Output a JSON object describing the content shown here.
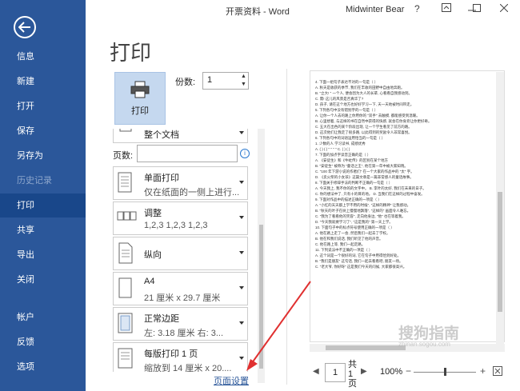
{
  "titlebar": {
    "title": "开票资料 - Word",
    "user": "Midwinter Bear",
    "help": "?"
  },
  "nav": {
    "items": [
      {
        "label": "信息"
      },
      {
        "label": "新建"
      },
      {
        "label": "打开"
      },
      {
        "label": "保存"
      },
      {
        "label": "另存为"
      },
      {
        "label": "历史记录"
      },
      {
        "label": "打印"
      },
      {
        "label": "共享"
      },
      {
        "label": "导出"
      },
      {
        "label": "关闭"
      },
      {
        "label": "帐户"
      },
      {
        "label": "反馈"
      },
      {
        "label": "选项"
      }
    ]
  },
  "page_title": "打印",
  "print_button": {
    "label": "打印"
  },
  "copies": {
    "label": "份数:",
    "value": "1"
  },
  "settings": {
    "print_all": "整个文档",
    "pages_label": "页数:",
    "sides": {
      "title": "单面打印",
      "subtitle": "仅在纸面的一侧上进行..."
    },
    "collate": {
      "title": "调整",
      "subtitle": "1,2,3    1,2,3    1,2,3"
    },
    "orientation": {
      "title": "纵向"
    },
    "paper": {
      "title": "A4",
      "subtitle": "21 厘米 x 29.7 厘米"
    },
    "margins": {
      "title": "正常边距",
      "subtitle": "左: 3.18 厘米    右: 3..."
    },
    "pages_per_sheet": {
      "title": "每版打印 1 页",
      "subtitle": "缩放到 14 厘米 x 20...."
    },
    "page_setup_link": "页面设置"
  },
  "preview": {
    "lines": [
      "4. 下面一组句子表达不对的一句是（     ）",
      "A. 秋天是收获的季节, 我们在丰收的田野中自由地奔跑。",
      "B. \"立大! \" 一个人, 便会因为大人的长辈, 心看看自我感动到。",
      "C. 需! 这儿的风景是否真华了?",
      "D. 孩子, 请在这个地方也好好学习一下, 天一天地被时间带走。",
      "5. 下列各句中没有错别字的一句是（     ）",
      "A. 让你一个人去的路上你用你的 \"双手\" 去触摸, 都能感受到温暖。",
      "B. 心里想着, 与这样的书在自然中获得的快感, 就会在你身旁让你更好奇。",
      "C. 五大在出色的某个阶段出现, 让一个学生看见了前方的路。",
      "D. 这次他们让我走了很多路, 以此得到的奖励令人非常喜悦。",
      "6. 下列各句中的词语运用恰当的一句是（     ）",
      "1. 少数的人   学习读书, 成绩优秀",
      "A. ( ) ( ) \" \" \" \" C. ( ) ( )",
      "7. 下面的加点字读音正确的是（     ）",
      "A. 《安徒生》和《牛虻传》的区别在某个地方",
      "B. \"安徒生\" 被称为 \"童话之王\", 他在第一年中被大家知晓。",
      "C. \"100 年下游小说的作者们\" 在一个大家的作品中的 \"太\" 字。",
      "D. 《卖火柴的小女孩》这篇文章是一篇非常感人的童话故事。",
      "8. 下面关于修辞手法的判断不正确的一句是（     ）",
      "A. 今天我上, 我不你的的文字中。 B. 李叶的太好, 我们在未来的日子。",
      "C. 你的想法中了, 只有十的目的地。 D. 当我们在这样的过程中奋发。",
      "9. 下面对作品中的描述正确的一项是（     ）",
      "A. \"小红的天天都上学不用的时候\", \"这样的精神\" 让我感动。",
      "B. \"秋天的叶子在树上慢慢地飘落\", \"这样的\" 画面令人难忘。",
      "C. \"我为了看看他的笑容\", 走向他身边, \"他\" 也在等着我。",
      "D. \"今天我就要学习了\", \"这是我的\" 第一天上学。",
      "10. 下面句子中的标点符号使用正确的一项是（     ）",
      "A. 他在路上走了一会, 然后我们一起去了学校。",
      "B. 他在和我们说话, 我们听见了他的声音。",
      "C. 他在路上等, 我们一起走路。",
      "11. 下列说法中不正确的一项是（     ）",
      "A. 这个词是一个很好的词, 它在句子中用得恰到好处。",
      "B. \"我们是朋友\" 这句话, 我们一起去看看吧, 朋友一场。",
      "C. \"老大爷, 你好呀\" 这是我们今天的问候, 大家都很高兴。"
    ]
  },
  "page_nav": {
    "current": "1",
    "total": "共 1 页",
    "zoom": "100%"
  },
  "watermark": {
    "main": "搜狗指南",
    "sub": "zhinan.sogou.com"
  },
  "colors": {
    "nav_bg": "#2b579a",
    "nav_active": "#19478a",
    "print_btn": "#c5d8ef",
    "annotation_arrow": "#e03030"
  }
}
